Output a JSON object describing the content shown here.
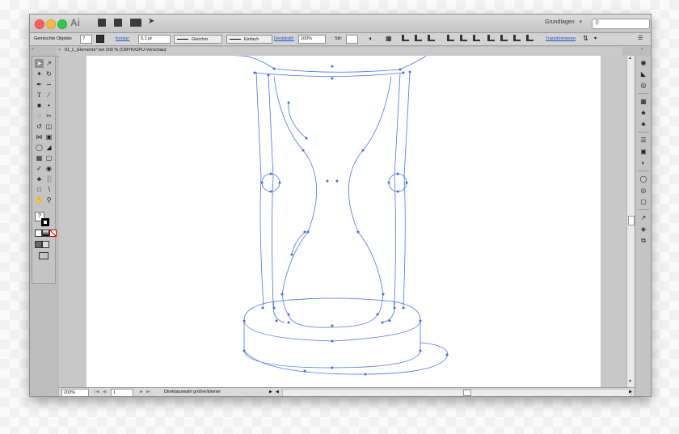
{
  "window": {
    "app_logo": "Ai",
    "workspace": "Grundlagen",
    "workspace_caret": "▾",
    "search_placeholder": ""
  },
  "control_bar": {
    "selection_type": "Gemischte Objekte",
    "question_marker": "?",
    "stroke_label": "Kontur:",
    "stroke_weight": "0,1 pt",
    "stroke_profile": "Gleichm.",
    "brush": "Einfach",
    "opacity_label": "Deckkraft:",
    "opacity_value": "100%",
    "style_label": "Stil:",
    "transform_link": "Transformieren"
  },
  "document": {
    "tab_label": "01_L_Elements* bei 200 % (CMYK/GPU-Vorschau)",
    "close_glyph": "×"
  },
  "status_bar": {
    "zoom": "200%",
    "artboard_number": "1",
    "tool_hint": "Direktauswahl größer/kleiner"
  },
  "colors": {
    "path_stroke": "#4a74e8",
    "anchor_fill": "#3e6be6",
    "window_chrome": "#bdbdbd",
    "canvas_bg": "#ffffff"
  },
  "tools": [
    "selection-tool",
    "direct-selection-tool",
    "magic-wand-tool",
    "lasso-tool",
    "pen-tool",
    "curvature-tool",
    "type-tool",
    "line-tool",
    "rectangle-tool",
    "paintbrush-tool",
    "shaper-tool",
    "eraser-tool",
    "rotate-tool",
    "scale-tool",
    "width-tool",
    "free-transform-tool",
    "shape-builder-tool",
    "perspective-tool",
    "mesh-tool",
    "gradient-tool",
    "eyedropper-tool",
    "blend-tool",
    "symbol-sprayer-tool",
    "graph-tool",
    "artboard-tool",
    "slice-tool",
    "hand-tool",
    "zoom-tool"
  ],
  "dock_icons": [
    "color-icon",
    "color-guide-icon",
    "swatches-icon",
    "brushes-icon",
    "symbols-icon",
    "stroke-icon",
    "gradient-icon",
    "transparency-icon",
    "appearance-icon",
    "graphic-styles-icon",
    "layers-icon",
    "artboards-icon",
    "links-icon",
    "align-icon",
    "pathfinder-icon"
  ]
}
